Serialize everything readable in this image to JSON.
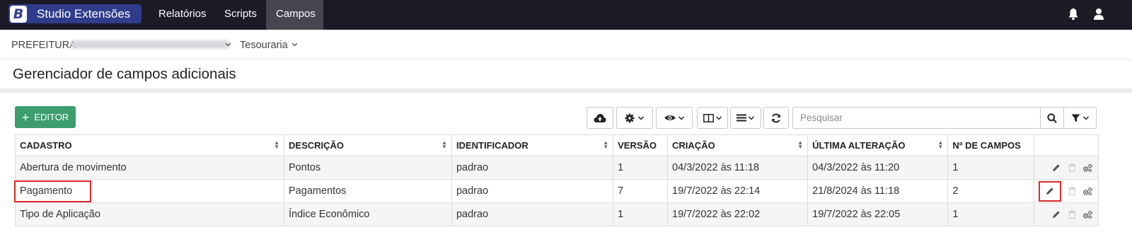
{
  "nav": {
    "brand_letter": "B",
    "brand": "Studio Extensões",
    "items": [
      "Relatórios",
      "Scripts",
      "Campos"
    ],
    "active": "Campos",
    "icons": [
      "bell-icon",
      "user-icon"
    ]
  },
  "breadcrumb": {
    "entity": "PREFEITURA",
    "module": "Tesouraria"
  },
  "page_title": "Gerenciador de campos adicionais",
  "toolbar": {
    "editor_label": "EDITOR",
    "search_placeholder": "Pesquisar"
  },
  "table": {
    "headers": [
      "CADASTRO",
      "DESCRIÇÃO",
      "IDENTIFICADOR",
      "VERSÃO",
      "CRIAÇÃO",
      "ÚLTIMA ALTERAÇÃO",
      "Nº DE CAMPOS"
    ],
    "rows": [
      [
        "Abertura de movimento",
        "Pontos",
        "padrao",
        "1",
        "04/3/2022 às 11:18",
        "04/3/2022 às 11:20",
        "1"
      ],
      [
        "Pagamento",
        "Pagamentos",
        "padrao",
        "7",
        "19/7/2022 às 22:14",
        "21/8/2024 às 11:18",
        "2"
      ],
      [
        "Tipo de Aplicação",
        "Índice Econômico",
        "padrao",
        "1",
        "19/7/2022 às 22:02",
        "19/7/2022 às 22:05",
        "1"
      ]
    ]
  },
  "colors": {
    "topbar": "#1c1b25",
    "brand": "#2f3c8b",
    "editor_button": "#3c9d6d",
    "highlight": "#e0262a"
  }
}
